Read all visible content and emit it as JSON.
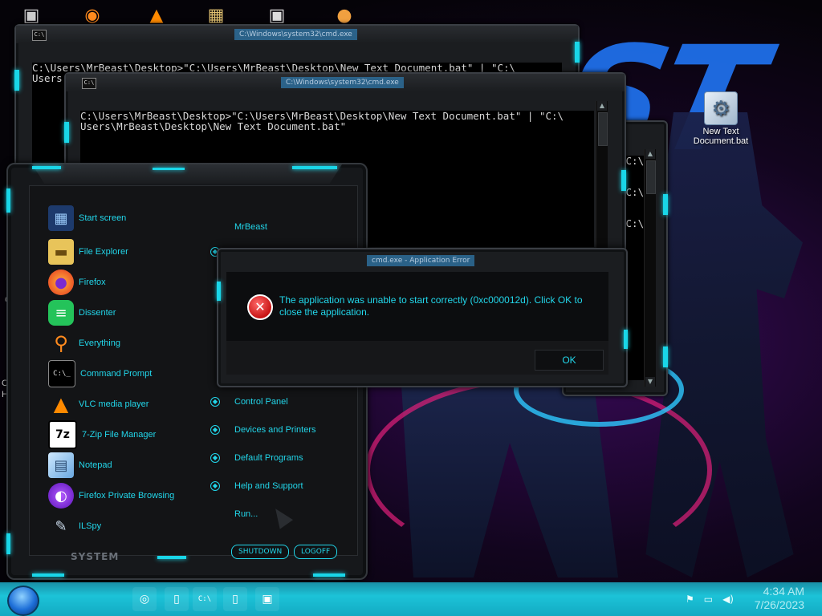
{
  "desktop": {
    "wallpaper_text": "ST",
    "top_icons": [
      "firefox-icon",
      "vlc-icon",
      "media-icon",
      "app-icon",
      "user-icon"
    ],
    "new_text_doc_icon_label": "New Text Document.bat",
    "edge_text_1": "C",
    "edge_text_2": "C",
    "edge_text_3": "H"
  },
  "cmd_window_back": {
    "title": "C:\\Windows\\system32\\cmd.exe",
    "icon_text": "C:\\",
    "lines": "C:\\Users\\MrBeast\\Desktop>\"C:\\Users\\MrBeast\\Desktop\\New Text Document.bat\" | \"C:\\\nUsers"
  },
  "cmd_window_front": {
    "title": "C:\\Windows\\system32\\cmd.exe",
    "icon_text": "C:\\",
    "lines": "C:\\Users\\MrBeast\\Desktop>\"C:\\Users\\MrBeast\\Desktop\\New Text Document.bat\" | \"C:\\\nUsers\\MrBeast\\Desktop\\New Text Document.bat\""
  },
  "cmd_window_right": {
    "lines": "'C:\\\n\n\n'C:\\\n\n\n'C:\\"
  },
  "start_menu": {
    "left_items": [
      {
        "label": "Start screen",
        "icon": "start-screen-icon"
      },
      {
        "label": "File Explorer",
        "icon": "folder-icon"
      },
      {
        "label": "Firefox",
        "icon": "firefox-icon"
      },
      {
        "label": "Dissenter",
        "icon": "dissenter-icon"
      },
      {
        "label": "Everything",
        "icon": "search-icon"
      },
      {
        "label": "Command Prompt",
        "icon": "terminal-icon"
      },
      {
        "label": "VLC media player",
        "icon": "vlc-icon"
      },
      {
        "label": "7-Zip File Manager",
        "icon": "7zip-icon"
      },
      {
        "label": "Notepad",
        "icon": "notepad-icon"
      },
      {
        "label": "Firefox Private Browsing",
        "icon": "private-browsing-icon"
      },
      {
        "label": "ILSpy",
        "icon": "ilspy-icon"
      }
    ],
    "user_name": "MrBeast",
    "right_items": [
      "Control Panel",
      "Devices and Printers",
      "Default Programs",
      "Help and Support",
      "Run..."
    ],
    "system_label": "SYSTEM",
    "shutdown_label": "SHUTDOWN",
    "logoff_label": "LOGOFF"
  },
  "error_dialog": {
    "title": "cmd.exe - Application Error",
    "message": "The application was unable to start correctly (0xc000012d). Click OK to close the application.",
    "ok_label": "OK"
  },
  "taskbar": {
    "pinned": [
      "start-orb",
      "chrome-icon",
      "explorer-icon",
      "cmd-icon",
      "window-icon",
      "window-icon"
    ],
    "clock_time": "4:34 AM",
    "clock_date": "7/26/2023",
    "tray_icons": [
      "flag-icon",
      "network-icon",
      "volume-icon"
    ]
  },
  "colors": {
    "accent": "#22d6ea",
    "frame": "#1b1d20",
    "error_red": "#c81414"
  }
}
